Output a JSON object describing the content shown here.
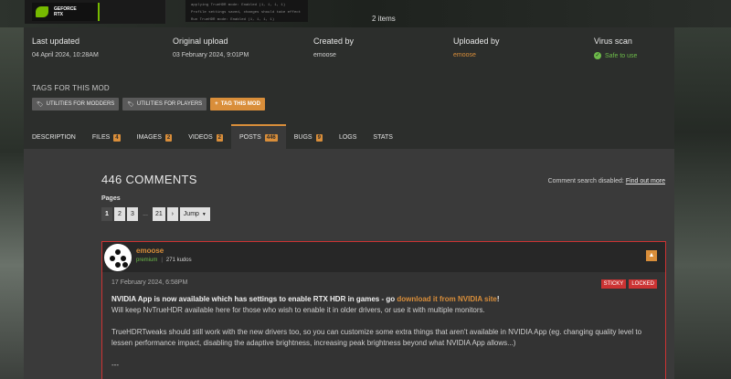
{
  "hero": {
    "thumb_logo_line1": "GEFORCE",
    "thumb_logo_line2": "RTX",
    "thumb_code_lines": [
      "applying TrueHDR mode: Enabled (1, 1, 1, 1)",
      "Profile settings saved, changes should take effect on next app launch",
      "Run TrueHDR mode: Enabled (1, 1, 1, 1)",
      "Press enter to exit..."
    ],
    "items_count": "2 items"
  },
  "meta": {
    "last_updated": {
      "label": "Last updated",
      "value": "04 April 2024,  10:28AM"
    },
    "original_upload": {
      "label": "Original upload",
      "value": "03 February 2024,  9:01PM"
    },
    "created_by": {
      "label": "Created by",
      "value": "emoose"
    },
    "uploaded_by": {
      "label": "Uploaded by",
      "value": "emoose"
    },
    "virus_scan": {
      "label": "Virus scan",
      "value": "Safe to use"
    }
  },
  "tags": {
    "title": "TAGS FOR THIS MOD",
    "items": [
      "UTILITIES FOR MODDERS",
      "UTILITIES FOR PLAYERS"
    ],
    "add_label": "TAG THIS MOD"
  },
  "tabs": [
    {
      "label": "DESCRIPTION",
      "count": ""
    },
    {
      "label": "FILES",
      "count": "4"
    },
    {
      "label": "IMAGES",
      "count": "2"
    },
    {
      "label": "VIDEOS",
      "count": "2"
    },
    {
      "label": "POSTS",
      "count": "446"
    },
    {
      "label": "BUGS",
      "count": "9"
    },
    {
      "label": "LOGS",
      "count": ""
    },
    {
      "label": "STATS",
      "count": ""
    }
  ],
  "comments": {
    "title": "446 COMMENTS",
    "search_note": "Comment search disabled:",
    "search_link": "Find out more",
    "pages_label": "Pages",
    "pager": {
      "p1": "1",
      "p2": "2",
      "p3": "3",
      "ellipsis": "...",
      "last": "21",
      "next": "›",
      "jump": "Jump"
    }
  },
  "post": {
    "author": "emoose",
    "role": "premium",
    "kudos": "271 kudos",
    "date": "17 February 2024, 6:58PM",
    "flags": {
      "sticky": "STICKY",
      "locked": "LOCKED"
    },
    "line1_a": "NVIDIA App is now available which has settings to enable RTX HDR in games - go ",
    "line1_link": "download it from NVIDIA site",
    "line1_b": "!",
    "line2": "Will keep NvTrueHDR available here for those who wish to enable it in older drivers, or use it with multiple monitors.",
    "para2": "TrueHDRTweaks should still work with the new drivers too, so you can customize some extra things that aren't available in NVIDIA App (eg. changing quality level to lessen performance impact, disabling the adaptive brightness, increasing peak brightness beyond what NVIDIA App allows...)",
    "divider": "---"
  },
  "colors": {
    "accent": "#d98e3a",
    "safe": "#6dbb4a",
    "flag": "#cc3333"
  }
}
